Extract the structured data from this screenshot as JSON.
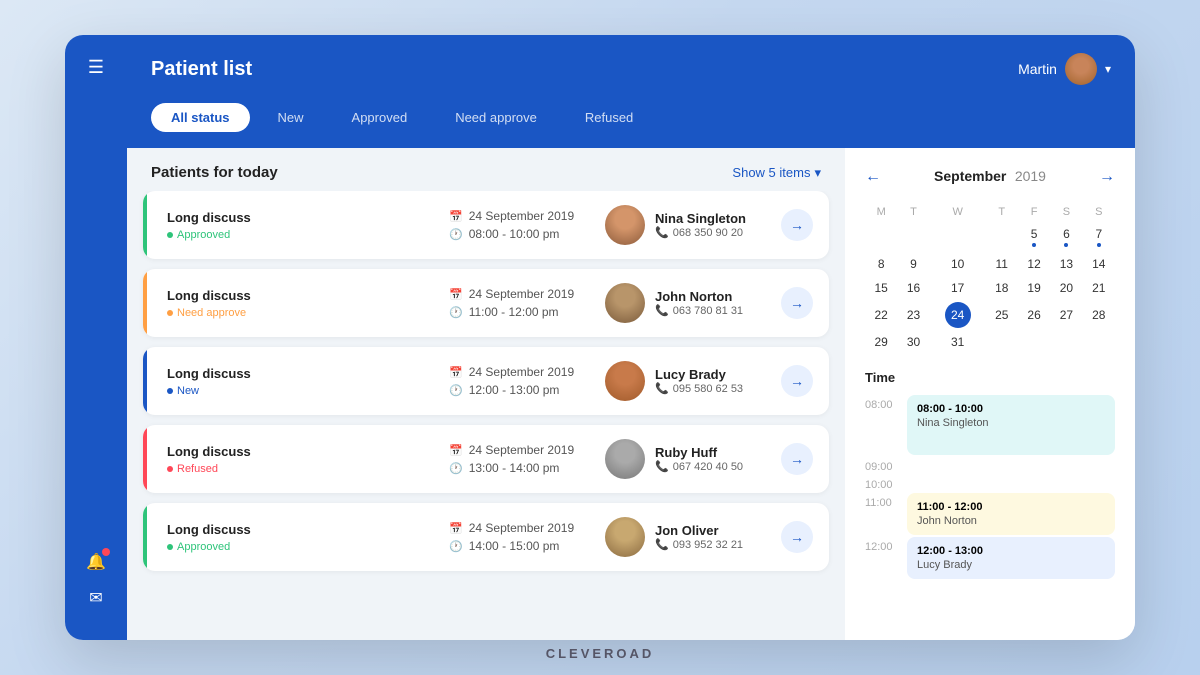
{
  "header": {
    "title": "Patient list",
    "user": "Martin",
    "chevron": "▾"
  },
  "tabs": [
    {
      "id": "all",
      "label": "All status",
      "active": true
    },
    {
      "id": "new",
      "label": "New"
    },
    {
      "id": "approved",
      "label": "Approved"
    },
    {
      "id": "need-approve",
      "label": "Need approve"
    },
    {
      "id": "refused",
      "label": "Refused"
    }
  ],
  "patients_section": {
    "title": "Patients for today",
    "show_items": "Show 5 items"
  },
  "patients": [
    {
      "id": 1,
      "title": "Long discuss",
      "status": "Approoved",
      "status_color": "#2ec47a",
      "accent_color": "#2ec47a",
      "date": "24 September 2019",
      "time": "08:00 - 10:00 pm",
      "name": "Nina Singleton",
      "phone": "068 350 90 20",
      "avatar": "nina"
    },
    {
      "id": 2,
      "title": "Long discuss",
      "status": "Need approve",
      "status_color": "#ff9f43",
      "accent_color": "#ff9f43",
      "date": "24 September 2019",
      "time": "11:00 - 12:00 pm",
      "name": "John Norton",
      "phone": "063 780 81 31",
      "avatar": "john"
    },
    {
      "id": 3,
      "title": "Long discuss",
      "status": "New",
      "status_color": "#1a56c4",
      "accent_color": "#1a56c4",
      "date": "24 September 2019",
      "time": "12:00 - 13:00 pm",
      "name": "Lucy Brady",
      "phone": "095 580 62 53",
      "avatar": "lucy"
    },
    {
      "id": 4,
      "title": "Long discuss",
      "status": "Refused",
      "status_color": "#ff4757",
      "accent_color": "#ff4757",
      "date": "24 September 2019",
      "time": "13:00 - 14:00 pm",
      "name": "Ruby Huff",
      "phone": "067 420 40 50",
      "avatar": "ruby"
    },
    {
      "id": 5,
      "title": "Long discuss",
      "status": "Approoved",
      "status_color": "#2ec47a",
      "accent_color": "#2ec47a",
      "date": "24 September 2019",
      "time": "14:00 - 15:00 pm",
      "name": "Jon Oliver",
      "phone": "093 952 32 21",
      "avatar": "jon"
    }
  ],
  "calendar": {
    "month": "September",
    "year": "2019",
    "days_header": [
      "M",
      "T",
      "W",
      "T",
      "F",
      "S",
      "S"
    ],
    "weeks": [
      [
        null,
        null,
        null,
        null,
        "5",
        "6",
        "7"
      ],
      [
        "8",
        "9",
        "10",
        "11",
        "12",
        "13",
        "14"
      ],
      [
        "15",
        "16",
        "17",
        "18",
        "19",
        "20",
        "21"
      ],
      [
        "22",
        "23",
        "24",
        "25",
        "26",
        "27",
        "28"
      ],
      [
        "29",
        "30",
        "31",
        null,
        null,
        null,
        null
      ]
    ],
    "dot_days": [
      "5",
      "6",
      "7"
    ],
    "today": "24",
    "time_section_title": "Time",
    "time_slots": [
      {
        "tick": "08:00",
        "event": {
          "title": "08:00 - 10:00",
          "sub": "Nina Singleton",
          "style": "teal"
        },
        "spacer": false
      },
      {
        "tick": "",
        "event": null,
        "spacer": true
      },
      {
        "tick": "09:00",
        "event": null,
        "spacer": false
      },
      {
        "tick": "",
        "event": null,
        "spacer": true
      },
      {
        "tick": "10:00",
        "event": null,
        "spacer": false
      },
      {
        "tick": "",
        "event": null,
        "spacer": true
      },
      {
        "tick": "11:00",
        "event": {
          "title": "11:00 - 12:00",
          "sub": "John Norton",
          "style": "yellow"
        },
        "spacer": false
      },
      {
        "tick": "12:00",
        "event": {
          "title": "12:00 - 13:00",
          "sub": "Lucy Brady",
          "style": "blue-light"
        },
        "spacer": false
      }
    ]
  },
  "branding": "CLEVEROAD",
  "icons": {
    "menu": "☰",
    "bell": "🔔",
    "mail": "✉",
    "calendar": "📅",
    "clock": "🕐",
    "phone": "📞",
    "arrow_right": "→",
    "prev": "←",
    "next": "→"
  }
}
